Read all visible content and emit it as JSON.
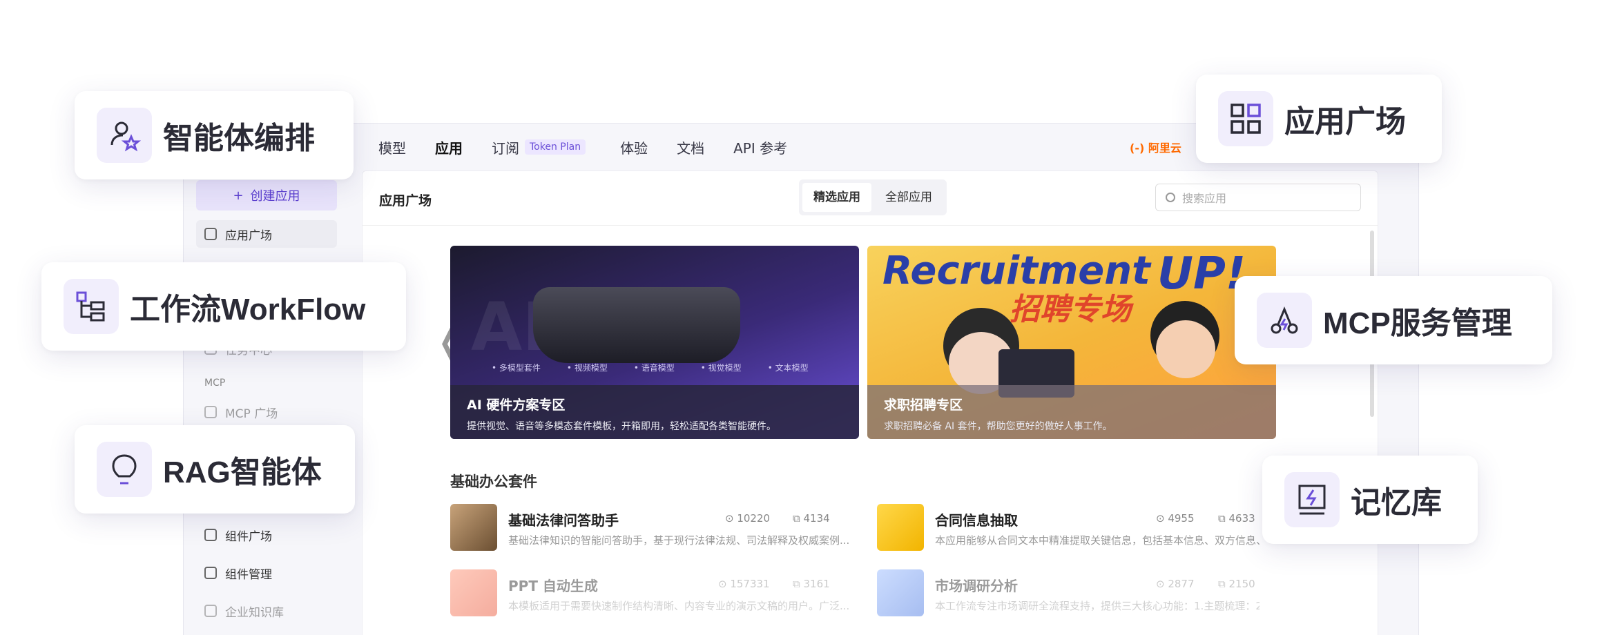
{
  "topnav": {
    "items": [
      "模型",
      "应用",
      "订阅",
      "体验",
      "文档",
      "API 参考"
    ],
    "badge": "Token Plan",
    "brand": "(-) 阿里云"
  },
  "sidebar": {
    "create_label": "创建应用",
    "app_market": "应用广场",
    "task_center": "任务中心",
    "mcp_section": "MCP",
    "mcp_market": "MCP 广场",
    "component_market": "组件广场",
    "component_manage": "组件管理",
    "knowledge_base": "企业知识库"
  },
  "main": {
    "title": "应用广场",
    "seg_featured": "精选应用",
    "seg_all": "全部应用",
    "search_placeholder": "搜索应用",
    "banners": [
      {
        "title": "AI 硬件方案专区",
        "desc": "提供视觉、语音等多模态套件模板，开箱即用，轻松适配各类智能硬件。",
        "bg_word": "AI 硬件",
        "tags": [
          "多模型套件",
          "视频模型",
          "语音模型",
          "视觉模型",
          "文本模型"
        ]
      },
      {
        "title": "求职招聘专区",
        "desc": "求职招聘必备 AI 套件，帮助您更好的做好人事工作。",
        "word_en": "Recruitment",
        "word_cn": "招聘专场",
        "word_up": "UP!"
      }
    ],
    "section_title": "基础办公套件",
    "apps": [
      {
        "name": "基础法律问答助手",
        "desc": "基础法律知识的智能问答助手，基于现行法律法规、司法解释及权威案例...",
        "views": "10220",
        "copies": "4134"
      },
      {
        "name": "合同信息抽取",
        "desc": "本应用能够从合同文本中精准提取关键信息，包括基本信息、双方信息、...",
        "views": "4955",
        "copies": "4633"
      },
      {
        "name": "PPT 自动生成",
        "desc": "本模板适用于需要快速制作结构清晰、内容专业的演示文稿的用户。广泛...",
        "views": "157331",
        "copies": "3161"
      },
      {
        "name": "市场调研分析",
        "desc": "本工作流专注市场调研全流程支持，提供三大核心功能：1.主题梳理：2...",
        "views": "2877",
        "copies": "2150"
      }
    ]
  },
  "cards": {
    "orchestration": "智能体编排",
    "app_market": "应用广场",
    "workflow": "工作流WorkFlow",
    "mcp": "MCP服务管理",
    "rag": "RAG智能体",
    "memory": "记忆库"
  },
  "colors": {
    "accent": "#6b4fd8",
    "accent_bg": "#f1eefc",
    "brand_orange": "#ff6a00"
  }
}
